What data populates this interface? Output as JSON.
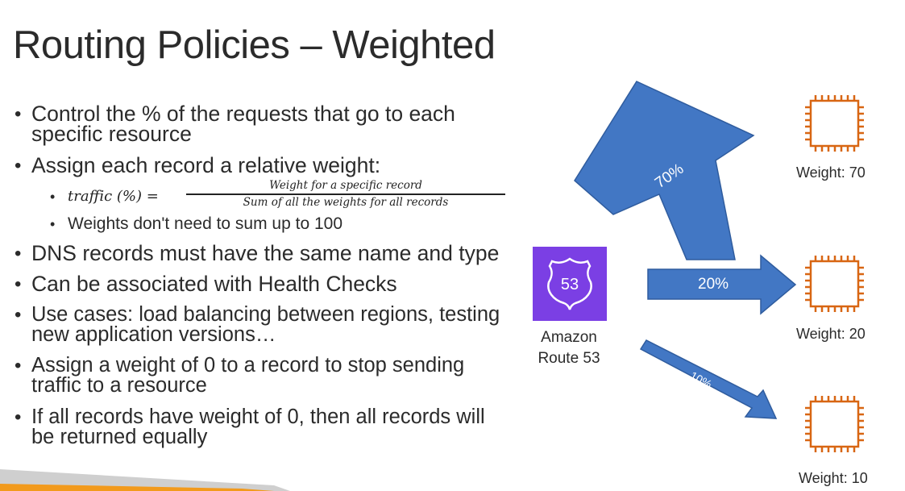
{
  "slide": {
    "title": "Routing Policies – Weighted",
    "bullets": [
      {
        "lines": [
          "Control the % of the requests that go to each",
          "specific resource"
        ]
      },
      {
        "lines": [
          "Assign each record a relative weight:"
        ]
      },
      {
        "lines": [
          "DNS records must have the same name and type"
        ]
      },
      {
        "lines": [
          "Can be associated with Health Checks"
        ]
      },
      {
        "lines": [
          "Use cases: load balancing between regions, testing",
          "new application versions…"
        ]
      },
      {
        "lines": [
          "Assign a weight of 0 to a record to stop sending",
          "traffic to a resource"
        ]
      },
      {
        "lines": [
          "If all records have weight of 0, then all records will",
          "be returned equally"
        ]
      }
    ],
    "sub_bullets": {
      "formula_lhs": "traffic (%) =",
      "formula_numerator": "Weight for a specific record",
      "formula_denominator": "Sum of all the weights for all records",
      "note": "Weights don't need to sum up to 100"
    }
  },
  "diagram": {
    "route53": {
      "line1": "Amazon",
      "line2": "Route 53",
      "badge": "53"
    },
    "arrows": [
      {
        "label": "70%"
      },
      {
        "label": "20%"
      },
      {
        "label": "10%"
      }
    ],
    "targets": [
      {
        "label": "Weight: 70"
      },
      {
        "label": "Weight: 20"
      },
      {
        "label": "Weight: 10"
      }
    ]
  },
  "colors": {
    "arrow_fill": "#4277C4",
    "arrow_stroke": "#2F5C9E",
    "route53_bg": "#7B3FE4",
    "compute_orange": "#D86613",
    "accent_bar": "#F29A1C"
  },
  "icons": {
    "bullet": "bullet-dot",
    "route53": "route53-shield-icon",
    "ec2": "ec2-chip-icon"
  }
}
